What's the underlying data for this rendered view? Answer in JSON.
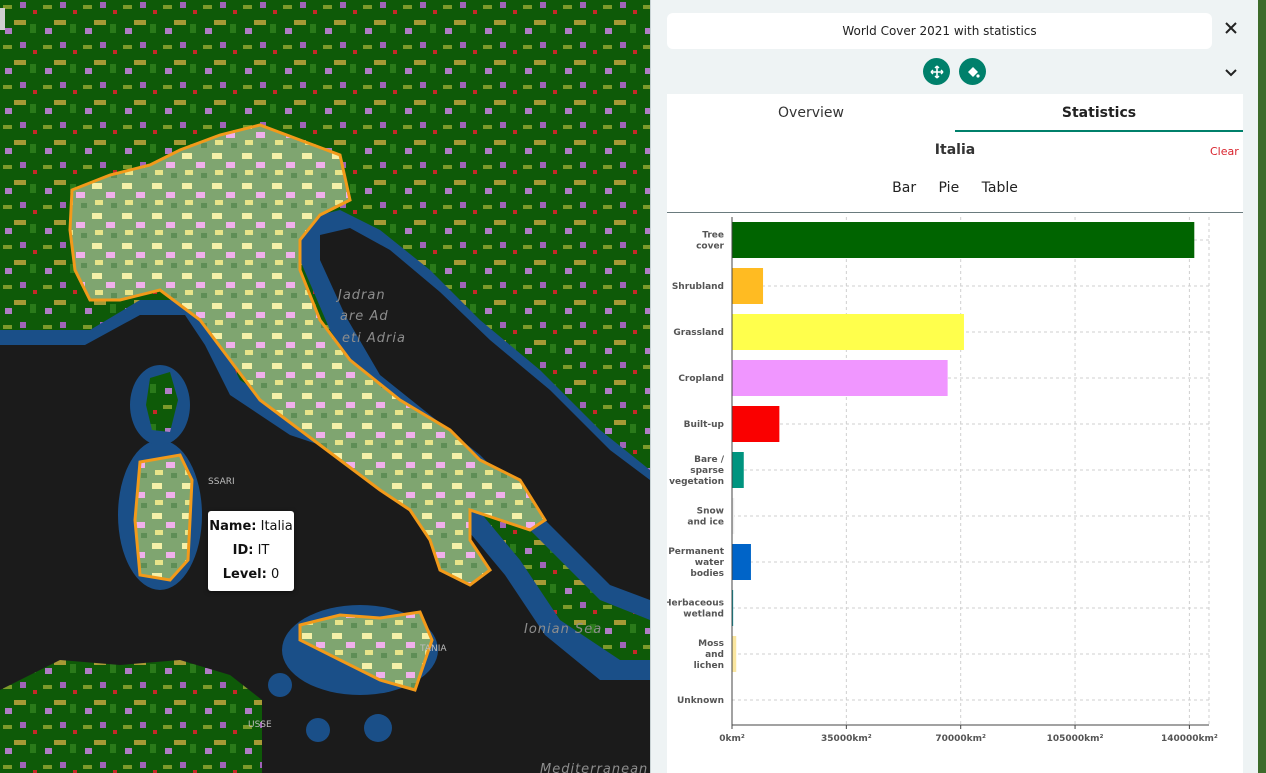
{
  "map": {
    "sea_labels": [
      "Jadran",
      "are Ad",
      "eti Adria",
      "Ionian Sea",
      "Mediterranean"
    ],
    "city_labels": [
      "SSARI",
      "TANIA",
      "USSE"
    ],
    "tooltip": {
      "name_label": "Name:",
      "name_value": "Italia",
      "id_label": "ID:",
      "id_value": "IT",
      "level_label": "Level:",
      "level_value": "0"
    }
  },
  "panel": {
    "title": "World Cover 2021 with statistics",
    "close_icon": "close-icon",
    "buttons": [
      {
        "icon": "move-icon"
      },
      {
        "icon": "paint-bucket-icon"
      }
    ],
    "chevron_icon": "chevron-down-icon",
    "tabs": [
      "Overview",
      "Statistics"
    ],
    "active_tab": "Statistics",
    "region": "Italia",
    "clear_label": "Clear",
    "views": [
      "Bar",
      "Pie",
      "Table"
    ]
  },
  "chart_data": {
    "type": "bar",
    "orientation": "horizontal",
    "unit": "km²",
    "categories": [
      {
        "lines": [
          "Tree",
          "cover"
        ],
        "value": 141500,
        "color": "#006400"
      },
      {
        "lines": [
          "Shrubland"
        ],
        "value": 9500,
        "color": "#ffbb22"
      },
      {
        "lines": [
          "Grassland"
        ],
        "value": 71000,
        "color": "#ffff4c"
      },
      {
        "lines": [
          "Cropland"
        ],
        "value": 66000,
        "color": "#f096ff"
      },
      {
        "lines": [
          "Built-up"
        ],
        "value": 14500,
        "color": "#fa0000"
      },
      {
        "lines": [
          "Bare /",
          "sparse",
          "vegetation"
        ],
        "value": 3600,
        "color": "#00947f"
      },
      {
        "lines": [
          "Snow",
          "and ice"
        ],
        "value": 700,
        "color": "#f0f0f0"
      },
      {
        "lines": [
          "Permanent",
          "water",
          "bodies"
        ],
        "value": 5800,
        "color": "#0064c8"
      },
      {
        "lines": [
          "Herbaceous",
          "wetland"
        ],
        "value": 350,
        "color": "#0096a0"
      },
      {
        "lines": [
          "Moss",
          "and",
          "lichen"
        ],
        "value": 1300,
        "color": "#fae6a0"
      },
      {
        "lines": [
          "Unknown"
        ],
        "value": 0,
        "color": "#cccccc"
      }
    ],
    "xlim": [
      0,
      146000
    ],
    "xticks": [
      {
        "value": 0,
        "label": "0km²"
      },
      {
        "value": 35000,
        "label": "35000km²"
      },
      {
        "value": 70000,
        "label": "70000km²"
      },
      {
        "value": 105000,
        "label": "105000km²"
      },
      {
        "value": 140000,
        "label": "140000km²"
      }
    ],
    "grid": true
  }
}
